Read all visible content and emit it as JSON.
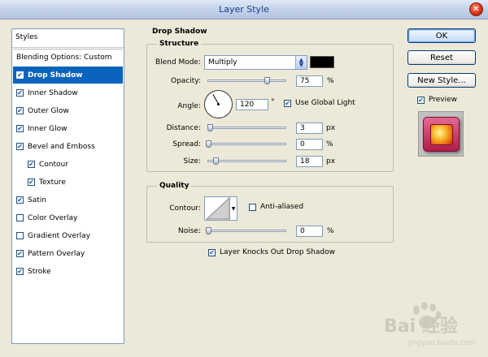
{
  "window": {
    "title": "Layer Style"
  },
  "styles_panel": {
    "header": "Styles",
    "items": [
      {
        "label": "Blending Options: Custom",
        "checkbox": false,
        "checked": false,
        "active": false,
        "indent": false
      },
      {
        "label": "Drop Shadow",
        "checkbox": true,
        "checked": true,
        "active": true,
        "indent": false
      },
      {
        "label": "Inner Shadow",
        "checkbox": true,
        "checked": true,
        "active": false,
        "indent": false
      },
      {
        "label": "Outer Glow",
        "checkbox": true,
        "checked": true,
        "active": false,
        "indent": false
      },
      {
        "label": "Inner Glow",
        "checkbox": true,
        "checked": true,
        "active": false,
        "indent": false
      },
      {
        "label": "Bevel and Emboss",
        "checkbox": true,
        "checked": true,
        "active": false,
        "indent": false
      },
      {
        "label": "Contour",
        "checkbox": true,
        "checked": true,
        "active": false,
        "indent": true
      },
      {
        "label": "Texture",
        "checkbox": true,
        "checked": true,
        "active": false,
        "indent": true
      },
      {
        "label": "Satin",
        "checkbox": true,
        "checked": true,
        "active": false,
        "indent": false
      },
      {
        "label": "Color Overlay",
        "checkbox": true,
        "checked": false,
        "active": false,
        "indent": false
      },
      {
        "label": "Gradient Overlay",
        "checkbox": true,
        "checked": false,
        "active": false,
        "indent": false
      },
      {
        "label": "Pattern Overlay",
        "checkbox": true,
        "checked": true,
        "active": false,
        "indent": false
      },
      {
        "label": "Stroke",
        "checkbox": true,
        "checked": true,
        "active": false,
        "indent": false
      }
    ]
  },
  "drop_shadow": {
    "section_title": "Drop Shadow",
    "structure": {
      "title": "Structure",
      "blend_mode_label": "Blend Mode:",
      "blend_mode_value": "Multiply",
      "blend_color": "#000000",
      "opacity_label": "Opacity:",
      "opacity_value": "75",
      "opacity_unit": "%",
      "opacity_fraction": 0.75,
      "angle_label": "Angle:",
      "angle_value": "120",
      "angle_unit": "°",
      "use_global_light_label": "Use Global Light",
      "use_global_light_checked": true,
      "distance_label": "Distance:",
      "distance_value": "3",
      "distance_unit": "px",
      "spread_label": "Spread:",
      "spread_value": "0",
      "spread_unit": "%",
      "size_label": "Size:",
      "size_value": "18",
      "size_unit": "px"
    },
    "quality": {
      "title": "Quality",
      "contour_label": "Contour:",
      "anti_aliased_label": "Anti-aliased",
      "anti_aliased_checked": false,
      "noise_label": "Noise:",
      "noise_value": "0",
      "noise_unit": "%"
    },
    "knockout_label": "Layer Knocks Out Drop Shadow",
    "knockout_checked": true
  },
  "buttons": {
    "ok": "OK",
    "reset": "Reset",
    "new_style": "New Style...",
    "preview_label": "Preview",
    "preview_checked": true
  },
  "watermark": {
    "text": "Bai 经验",
    "url": "jingyan.baidu.com"
  },
  "colors": {
    "accent": "#0a64bd",
    "titlebar_text": "#15428b"
  }
}
